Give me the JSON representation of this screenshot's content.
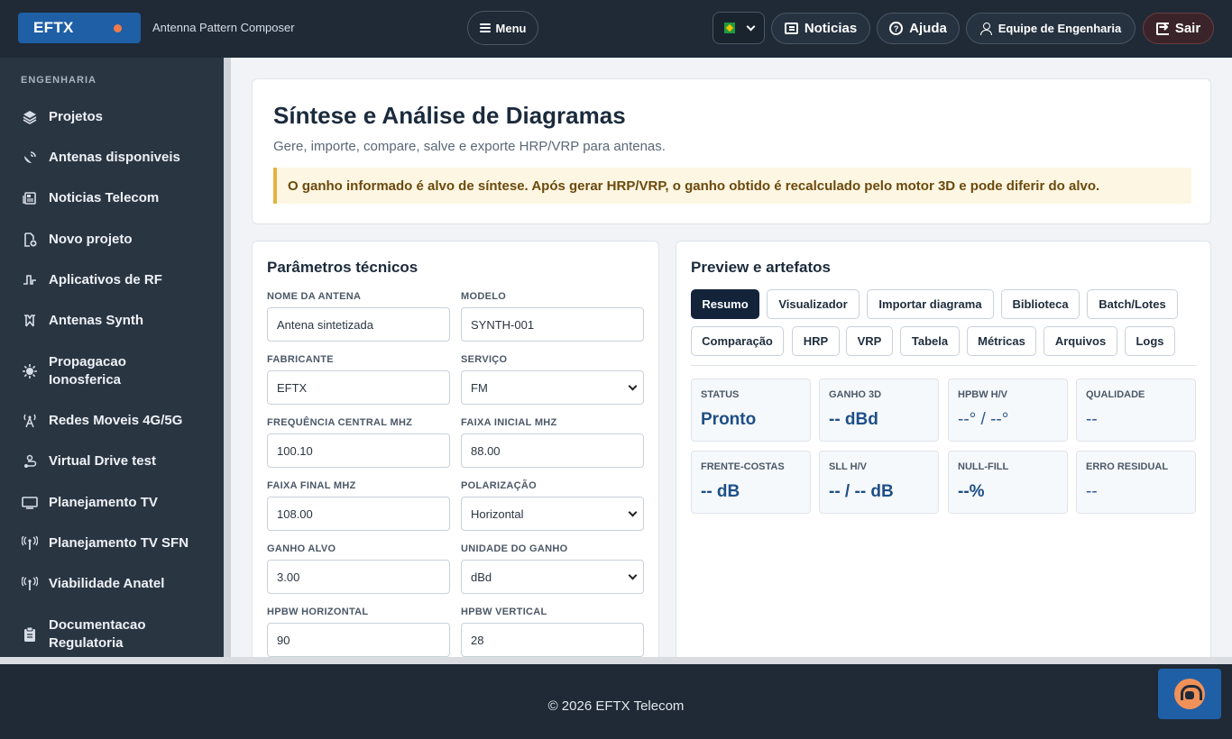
{
  "header": {
    "brand": "EFTX",
    "app_name": "Antenna Pattern Composer",
    "menu_label": "Menu",
    "language_flag": "brazil-flag",
    "news_label": "Noticias",
    "help_label": "Ajuda",
    "team_label": "Equipe de Engenharia",
    "exit_label": "Sair"
  },
  "sidebar": {
    "section": "ENGENHARIA",
    "items": [
      {
        "label": "Projetos",
        "icon": "layers-icon"
      },
      {
        "label": "Antenas disponiveis",
        "icon": "satellite-dish-icon"
      },
      {
        "label": "Noticias Telecom",
        "icon": "newspaper-icon"
      },
      {
        "label": "Novo projeto",
        "icon": "new-file-icon"
      },
      {
        "label": "Aplicativos de RF",
        "icon": "signal-wave-icon"
      },
      {
        "label": "Antenas Synth",
        "icon": "antenna-synth-icon"
      },
      {
        "label": "Propagacao Ionosferica",
        "icon": "sun-icon"
      },
      {
        "label": "Redes Moveis 4G/5G",
        "icon": "cell-tower-icon"
      },
      {
        "label": "Virtual Drive test",
        "icon": "route-icon"
      },
      {
        "label": "Planejamento TV",
        "icon": "monitor-icon"
      },
      {
        "label": "Planejamento TV SFN",
        "icon": "broadcast-icon"
      },
      {
        "label": "Viabilidade Anatel",
        "icon": "broadcast-icon"
      },
      {
        "label": "Documentacao Regulatoria",
        "icon": "clipboard-icon"
      }
    ]
  },
  "hero": {
    "title": "Síntese e Análise de Diagramas",
    "subtitle": "Gere, importe, compare, salve e exporte HRP/VRP para antenas.",
    "alert": "O ganho informado é alvo de síntese. Após gerar HRP/VRP, o ganho obtido é recalculado pelo motor 3D e pode diferir do alvo."
  },
  "params": {
    "title": "Parâmetros técnicos",
    "fields": [
      {
        "label": "Nome da antena",
        "value": "Antena sintetizada",
        "type": "input"
      },
      {
        "label": "Modelo",
        "value": "SYNTH-001",
        "type": "input"
      },
      {
        "label": "Fabricante",
        "value": "EFTX",
        "type": "input"
      },
      {
        "label": "Serviço",
        "value": "FM",
        "type": "select"
      },
      {
        "label": "Frequência central MHz",
        "value": "100.10",
        "type": "input"
      },
      {
        "label": "Faixa inicial MHz",
        "value": "88.00",
        "type": "input"
      },
      {
        "label": "Faixa final MHz",
        "value": "108.00",
        "type": "input"
      },
      {
        "label": "Polarização",
        "value": "Horizontal",
        "type": "select"
      },
      {
        "label": "Ganho alvo",
        "value": "3.00",
        "type": "input"
      },
      {
        "label": "Unidade do ganho",
        "value": "dBd",
        "type": "select"
      },
      {
        "label": "HPBW horizontal",
        "value": "90",
        "type": "input"
      },
      {
        "label": "HPBW vertical",
        "value": "28",
        "type": "input"
      }
    ]
  },
  "preview": {
    "title": "Preview e artefatos",
    "tabs": [
      "Resumo",
      "Visualizador",
      "Importar diagrama",
      "Biblioteca",
      "Batch/Lotes",
      "Comparação",
      "HRP",
      "VRP",
      "Tabela",
      "Métricas",
      "Arquivos",
      "Logs"
    ],
    "active_tab": "Resumo",
    "metrics": [
      {
        "label": "STATUS",
        "value": "Pronto"
      },
      {
        "label": "GANHO 3D",
        "value": "-- dBd"
      },
      {
        "label": "HPBW H/V",
        "value": "--° / --°"
      },
      {
        "label": "QUALIDADE",
        "value": "--"
      },
      {
        "label": "FRENTE-COSTAS",
        "value": "-- dB"
      },
      {
        "label": "SLL H/V",
        "value": "-- / -- dB"
      },
      {
        "label": "NULL-FILL",
        "value": "--%"
      },
      {
        "label": "ERRO RESIDUAL",
        "value": "--"
      }
    ]
  },
  "footer": {
    "copyright": "© 2026 EFTX Telecom"
  },
  "colors": {
    "topbar": "#1f2a36",
    "sidebar": "#2a3542",
    "brand": "#1f5fa6",
    "accent_dot": "#f07a4a",
    "alert_border": "#e3b341",
    "metric_value": "#1e4f86"
  }
}
